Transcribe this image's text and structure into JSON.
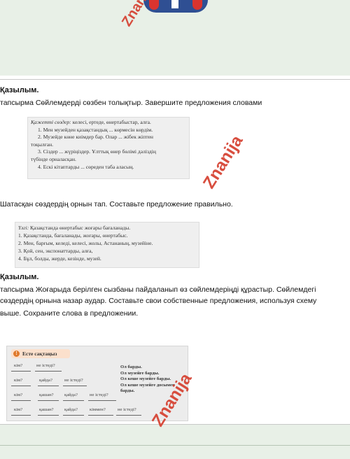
{
  "box1": {
    "title_label": "Қажетті сөздер:",
    "title_words": " келесі, ертеде, өнертабыстар, алға.",
    "lines": [
      "1. Мен музейден қазақстандық ... көрмесін көрдім.",
      "2. Музейде көне киімдер бар. Олар ... жібек жіптен",
      "тоқылған.",
      "3. Сіздер ... жүріңіздер. Ұлттық өнер бөлімі дәліздің",
      "түбінде орналасқан.",
      "4. Ескі кітаптарды ... сөреден таба аласың."
    ]
  },
  "section1": {
    "heading": "Қазылым.",
    "task": "тапсырма  Сөйлемдерді сөзбен толықтыр. Завершите предложения словами"
  },
  "section2": {
    "task": "Шатасқан сөздердің орнын тап. Составьте предложение правильно."
  },
  "box2": {
    "example_label": "Үлгі:",
    "example_text": " Қазақстанда өнертабыс жоғары бағаланады.",
    "lines": [
      "1. Қазақстанда, бағаланады, жоғары, өнертабыс.",
      "2. Мен, барғым, келеді, келесі, жолы, Астананың, музейіне.",
      "3. Қой, сен, экспонаттарды, алға,",
      "4. Бұл, болды, жерде, кезінде, музей."
    ]
  },
  "section3": {
    "heading": "Қазылым.",
    "lines": [
      "тапсырма Жоғарыда берілген сызбаны пайдаланып өз сөйлемдеріңді құрастыр. Сөйлемдегі",
      "сөздердің орнына назар аудар. Составьте свои собственные предложения, используя схему",
      "выше. Сохраните слова в предложении."
    ]
  },
  "box3": {
    "title": "Есте сақтаңыз",
    "rows": [
      [
        "кім?",
        "не істеді?"
      ],
      [
        "кім?",
        "қайда?",
        "не істеді?"
      ],
      [
        "кім?",
        "қашан?",
        "қайда?",
        "не істеді?"
      ],
      [
        "кім?",
        "қашан?",
        "қайда?",
        "кіммен?",
        "не істеді?"
      ]
    ],
    "examples": [
      "Ол барды.",
      "Ол музейге барды.",
      "Ол кеше музейге барды.",
      "Ол кеше музейге досымен",
      "барды."
    ]
  },
  "watermark": {
    "text": "Znanija"
  },
  "colors": {
    "band": "#e8f0e7",
    "watermark": "#d64535",
    "title_bg": "#fbe0cc"
  }
}
